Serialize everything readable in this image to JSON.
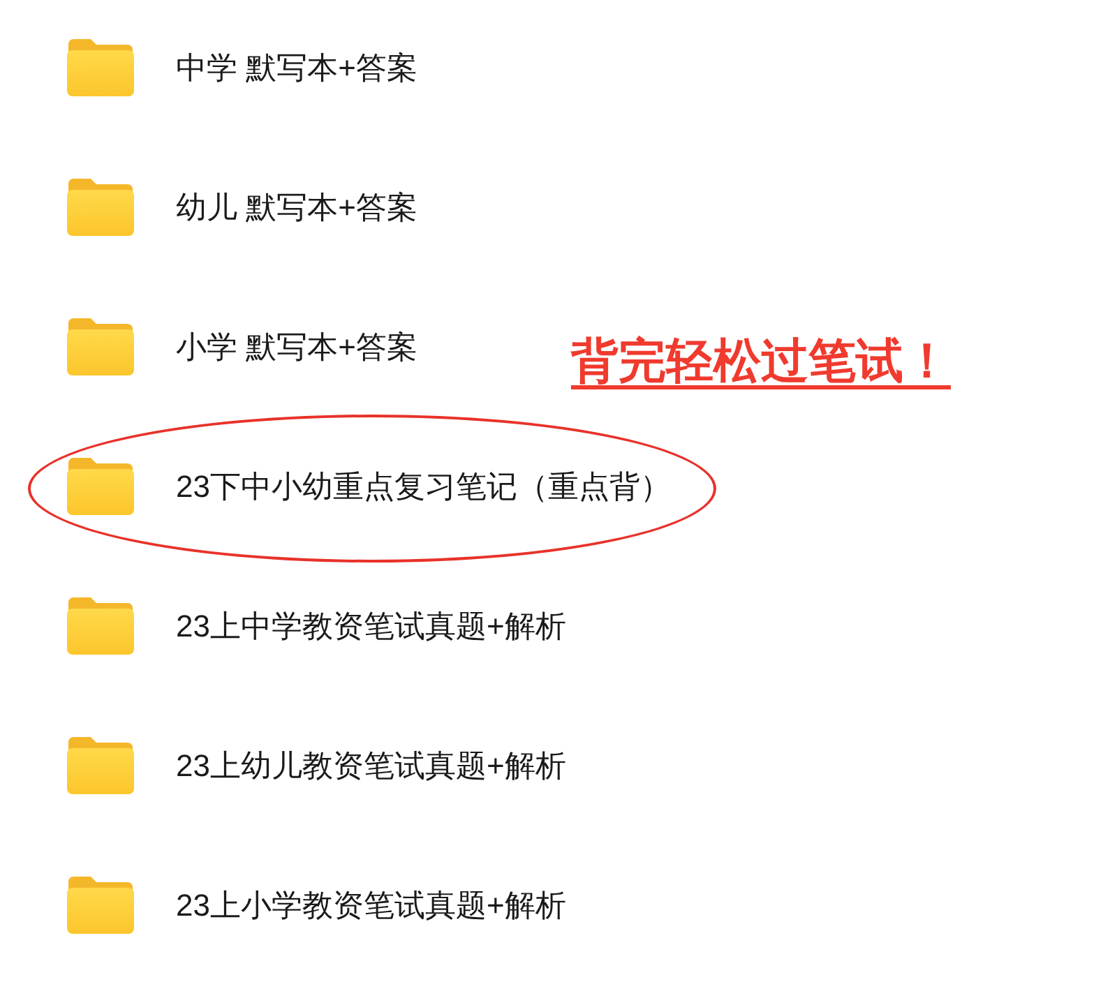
{
  "folders": [
    {
      "name": "中学 默写本+答案",
      "circled": false
    },
    {
      "name": "幼儿 默写本+答案",
      "circled": false
    },
    {
      "name": "小学 默写本+答案",
      "circled": false
    },
    {
      "name": "23下中小幼重点复习笔记（重点背）",
      "circled": true
    },
    {
      "name": "23上中学教资笔试真题+解析",
      "circled": false
    },
    {
      "name": "23上幼儿教资笔试真题+解析",
      "circled": false
    },
    {
      "name": "23上小学教资笔试真题+解析",
      "circled": false
    }
  ],
  "annotation": {
    "text": "背完轻松过笔试！"
  }
}
